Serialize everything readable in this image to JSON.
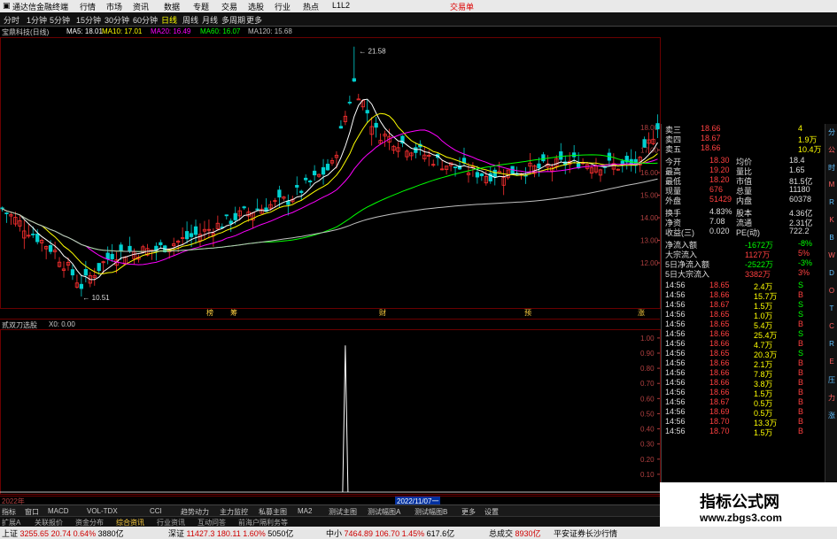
{
  "titlebar": {
    "app_title": "通达信金融终端",
    "menus": [
      "行情",
      "市场",
      "资讯",
      "数据",
      "专题",
      "交易",
      "选股",
      "行业",
      "热点",
      "L1L2"
    ],
    "right": "交易单"
  },
  "tabs": [
    "分时",
    "1分钟",
    "5分钟",
    "15分钟",
    "30分钟",
    "60分钟",
    "日线",
    "周线",
    "月线",
    "多周期",
    "更多"
  ],
  "active_tab": "日线",
  "legend": {
    "stock": "宝鼎科技(日线)",
    "ma5": "MA5: 18.01",
    "ma10": "MA10: 17.01",
    "ma20": "MA20: 16.49",
    "ma60": "MA60: 16.07",
    "ma120": "MA120: 15.68"
  },
  "main_chart": {
    "high_label": "21.58",
    "low_label": "10.51",
    "price_ticks": [
      "18.00",
      "17.00",
      "16.00",
      "15.00",
      "14.00",
      "13.00",
      "12.00"
    ],
    "markers": [
      "榜",
      "筹",
      "财",
      "预",
      "涨"
    ]
  },
  "sub_chart": {
    "title": "贰双刀选股",
    "value": "X0: 0.00",
    "ticks": [
      "1.00",
      "0.90",
      "0.80",
      "0.70",
      "0.60",
      "0.50",
      "0.40",
      "0.30",
      "0.20",
      "0.10"
    ],
    "current": "0.70"
  },
  "dates": {
    "start": "2022年",
    "cursor": "2022/11/07一"
  },
  "quote_panel": {
    "ask": [
      {
        "label": "卖三",
        "price": "18.66",
        "vol": "4"
      },
      {
        "label": "卖四",
        "price": "18.67",
        "vol": "1.9万"
      },
      {
        "label": "卖五",
        "price": "18.66",
        "vol": "10.4万"
      }
    ],
    "stats": [
      {
        "l1": "今开",
        "v1": "18.30",
        "l2": "均价",
        "v2": "18.4"
      },
      {
        "l1": "最高",
        "v1": "19.20",
        "l2": "量比",
        "v2": "1.65"
      },
      {
        "l1": "最低",
        "v1": "18.20",
        "l2": "市值",
        "v2": "81.5亿"
      },
      {
        "l1": "现量",
        "v1": "676",
        "l2": "总量",
        "v2": "11180"
      },
      {
        "l1": "外盘",
        "v1": "51429",
        "l2": "内盘",
        "v2": "60378"
      }
    ],
    "stats2": [
      {
        "l1": "换手",
        "v1": "4.83%",
        "l2": "股本",
        "v2": "4.36亿"
      },
      {
        "l1": "净资",
        "v1": "7.08",
        "l2": "流通",
        "v2": "2.31亿"
      },
      {
        "l1": "收益(三)",
        "v1": "0.020",
        "l2": "PE(动)",
        "v2": "722.2"
      }
    ],
    "flows": [
      {
        "label": "净流入额",
        "value": "-1672万",
        "pct": "-8%"
      },
      {
        "label": "大宗流入",
        "value": "1127万",
        "pct": "5%"
      },
      {
        "label": "5日净流入额",
        "value": "-2522万",
        "pct": "-3%"
      },
      {
        "label": "5日大宗流入",
        "value": "3382万",
        "pct": "3%"
      }
    ],
    "ticks": [
      {
        "t": "14:56",
        "p": "18.65",
        "v": "2.4万",
        "s": "S"
      },
      {
        "t": "14:56",
        "p": "18.66",
        "v": "15.7万",
        "s": "B"
      },
      {
        "t": "14:56",
        "p": "18.67",
        "v": "1.5万",
        "s": "S"
      },
      {
        "t": "14:56",
        "p": "18.65",
        "v": "1.0万",
        "s": "S"
      },
      {
        "t": "14:56",
        "p": "18.65",
        "v": "5.4万",
        "s": "B"
      },
      {
        "t": "14:56",
        "p": "18.66",
        "v": "25.4万",
        "s": "S"
      },
      {
        "t": "14:56",
        "p": "18.66",
        "v": "4.7万",
        "s": "B"
      },
      {
        "t": "14:56",
        "p": "18.65",
        "v": "20.3万",
        "s": "S"
      },
      {
        "t": "14:56",
        "p": "18.66",
        "v": "2.1万",
        "s": "B"
      },
      {
        "t": "14:56",
        "p": "18.66",
        "v": "7.8万",
        "s": "B"
      },
      {
        "t": "14:56",
        "p": "18.66",
        "v": "3.8万",
        "s": "B"
      },
      {
        "t": "14:56",
        "p": "18.66",
        "v": "1.5万",
        "s": "B"
      },
      {
        "t": "14:56",
        "p": "18.67",
        "v": "0.5万",
        "s": "B"
      },
      {
        "t": "14:56",
        "p": "18.69",
        "v": "0.5万",
        "s": "B"
      },
      {
        "t": "14:56",
        "p": "18.70",
        "v": "13.3万",
        "s": "B"
      },
      {
        "t": "14:56",
        "p": "18.70",
        "v": "1.5万",
        "s": "B"
      }
    ],
    "footer": "图文F10"
  },
  "sidebar_items": [
    "分",
    "公",
    "时",
    "MACD",
    "RSI",
    "KDJ",
    "BOLL",
    "WR",
    "DMI",
    "OBV",
    "TRIX",
    "CCI",
    "ROC",
    "EXPMA",
    "压",
    "力",
    "涨"
  ],
  "indicator_tabs": [
    "指标",
    "窗口",
    "MACD",
    "VOL-TDX",
    "CCI",
    "趋势动力",
    "主力监控",
    "私募主图",
    "MA2",
    "测试主图",
    "测试幅图A",
    "测试幅图B",
    "更多",
    "设置"
  ],
  "indicator_tabs2": [
    "扩展A",
    "关联报价",
    "资金分布",
    "综合资讯",
    "行业资讯",
    "互动问答",
    "前海户隔利务等"
  ],
  "statusbar": [
    {
      "label": "上证",
      "val": "3255.65",
      "chg": "20.74",
      "pct": "0.64%",
      "amt": "3880亿"
    },
    {
      "label": "深证",
      "val": "11427.3",
      "chg": "180.11",
      "pct": "1.60%",
      "amt": "5050亿"
    },
    {
      "label": "中小",
      "val": "7464.89",
      "chg": "106.70",
      "pct": "1.45%",
      "amt": "617.6亿"
    },
    {
      "label": "总成交",
      "val": "8930亿"
    }
  ],
  "statusbar_right": "平安证券长沙行情",
  "watermark": {
    "title": "指标公式网",
    "url": "www.zbgs3.com"
  },
  "colors": {
    "up": "#ff3030",
    "down": "#00d0d0",
    "ma5": "#ffffff",
    "ma10": "#ffff00",
    "ma20": "#ff00ff",
    "ma60": "#00ff00",
    "ma120": "#c0c0c0",
    "accent": "#ffff00"
  }
}
